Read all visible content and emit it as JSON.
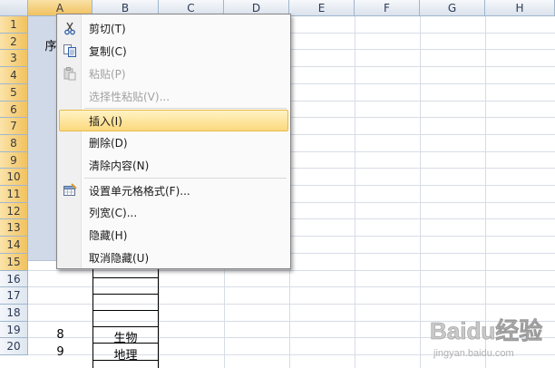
{
  "sheet": {
    "columns": [
      "A",
      "B",
      "C",
      "D",
      "E",
      "F",
      "G",
      "H"
    ],
    "selected_column": "A",
    "rows": [
      "1",
      "2",
      "3",
      "4",
      "5",
      "6",
      "7",
      "8",
      "9",
      "10",
      "11",
      "12",
      "13",
      "14",
      "15",
      "16",
      "17",
      "18",
      "19",
      "20"
    ],
    "selected_rows_from": 1,
    "selected_rows_to": 15,
    "cells": {
      "a2_partial": "序",
      "a19": "8",
      "b19": "生物",
      "a20": "9",
      "b20": "地理"
    }
  },
  "context_menu": {
    "items": [
      {
        "label": "剪切(T)",
        "icon": "scissors-icon",
        "enabled": true
      },
      {
        "label": "复制(C)",
        "icon": "copy-icon",
        "enabled": true
      },
      {
        "label": "粘贴(P)",
        "icon": "paste-icon",
        "enabled": false
      },
      {
        "label": "选择性粘贴(V)...",
        "icon": "",
        "enabled": false
      },
      {
        "label": "插入(I)",
        "icon": "",
        "enabled": true,
        "highlighted": true
      },
      {
        "label": "删除(D)",
        "icon": "",
        "enabled": true
      },
      {
        "label": "清除内容(N)",
        "icon": "",
        "enabled": true
      },
      {
        "label": "设置单元格格式(F)...",
        "icon": "format-cells-icon",
        "enabled": true
      },
      {
        "label": "列宽(C)...",
        "icon": "",
        "enabled": true
      },
      {
        "label": "隐藏(H)",
        "icon": "",
        "enabled": true
      },
      {
        "label": "取消隐藏(U)",
        "icon": "",
        "enabled": true
      }
    ]
  },
  "watermark": {
    "text": "Baidu经验",
    "sub": "jingyan.baidu.com"
  },
  "colors": {
    "selection_header": "#f1c15f",
    "selected_cells": "#cfd9e8",
    "menu_highlight": "#fcd97d"
  }
}
